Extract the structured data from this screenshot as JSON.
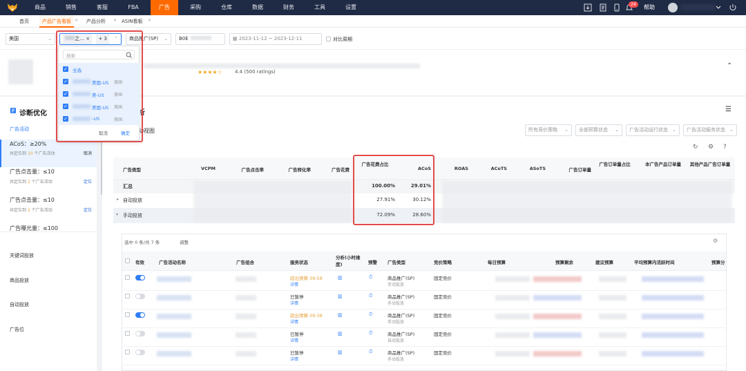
{
  "nav": {
    "items": [
      "商品",
      "销售",
      "客服",
      "FBA",
      "广告",
      "采购",
      "仓库",
      "数据",
      "财务",
      "工具",
      "设置"
    ],
    "help": "帮助",
    "badge": "24"
  },
  "tabs": [
    "首页",
    "产品广告看板",
    "产品分析",
    "ASIN看板"
  ],
  "filters": {
    "country": "美国",
    "shops_chip": "之…",
    "shops_more": "+ 3",
    "ad_type": "商品推广(SP)",
    "asin": "B0E",
    "date_start": "2023-11-12",
    "date_sep": "~",
    "date_end": "2023-12-11",
    "compare_label": "对比周期"
  },
  "shop_dropdown": {
    "search_placeholder": "搜索",
    "select_all": "全选",
    "options": [
      {
        "name": "美国-US",
        "region": "美国"
      },
      {
        "name": "美-US",
        "region": "美国"
      },
      {
        "name": "美国-US",
        "region": "美国"
      },
      {
        "name": "-US",
        "region": "美国"
      }
    ],
    "cancel": "取消",
    "ok": "确定"
  },
  "product": {
    "rating": "4.4 (500 ratings)"
  },
  "sidebar": {
    "title": "诊断优化",
    "section": "广告活动",
    "items": [
      {
        "title": "ACoS：≥20%",
        "sub_prefix": "共定位到",
        "count": "10",
        "sub_suffix": "个广告活动",
        "action": "取消"
      },
      {
        "title": "广告点击量：≤10",
        "sub_prefix": "共定位到",
        "count": "2",
        "sub_suffix": "个广告活动",
        "action": "定位"
      },
      {
        "title": "广告点击量：≤10",
        "sub_prefix": "共定位到",
        "count": "2",
        "sub_suffix": "个广告活动",
        "action": "定位"
      },
      {
        "title": "广告曝光量：≤100",
        "sub_prefix": "",
        "count": "",
        "sub_suffix": "",
        "action": ""
      }
    ],
    "links": [
      "关键词投放",
      "商品投放",
      "自动投放",
      "广告位"
    ]
  },
  "main": {
    "title_tail": "析",
    "view_tail": "动视图",
    "filters": [
      "所有竞价策略",
      "全部预算状态",
      "广告活动运行状态",
      "广告活动服务状态"
    ],
    "headers": [
      "广告类型",
      "VCPM",
      "广告点击率",
      "广告转化率",
      "广告花费",
      "广告花费占比",
      "ACoS",
      "ROAS",
      "ACoTS",
      "ASoTS",
      "广告订单量",
      "广告订单量占比",
      "本广告产品订单量",
      "其他产品广告订单量"
    ],
    "rows": [
      {
        "type": "汇总",
        "spend_share": "100.00%",
        "acos": "29.01%"
      },
      {
        "type": "自动投放",
        "spend_share": "27.91%",
        "acos": "30.12%"
      },
      {
        "type": "手动投放",
        "spend_share": "72.09%",
        "acos": "28.60%"
      }
    ]
  },
  "campaigns": {
    "selection": "选中 0 条/共 7 条",
    "adjust": "调整",
    "headers": [
      "有效",
      "广告活动名称",
      "广告组合",
      "服务状态",
      "分析(小时维度)",
      "预警",
      "广告类型",
      "竞价策略",
      "每日预算",
      "预算剩余",
      "建议预算",
      "平均预算内活跃时间",
      "预算分"
    ],
    "rows": [
      {
        "on": true,
        "status": "超出预算 09:58",
        "type": "商品推广(SP)",
        "targeting": "手动投放",
        "strategy": "固定竞价"
      },
      {
        "on": false,
        "status": "已暂停",
        "type": "商品推广(SP)",
        "targeting": "手动投放",
        "strategy": "固定竞价"
      },
      {
        "on": true,
        "status": "超出预算 09:38",
        "type": "商品推广(SP)",
        "targeting": "手动投放",
        "strategy": "固定竞价"
      },
      {
        "on": false,
        "status": "已暂停",
        "type": "商品推广(SP)",
        "targeting": "自动投放",
        "strategy": "固定竞价"
      },
      {
        "on": false,
        "status": "已暂停",
        "type": "商品推广(SP)",
        "targeting": "手动投放",
        "strategy": "固定竞价"
      }
    ],
    "detail": "详情",
    "status_warn_color": "#e6a23c"
  }
}
